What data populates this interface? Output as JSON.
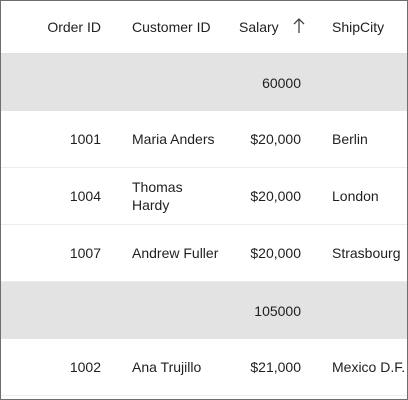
{
  "grid": {
    "columns": [
      "Order ID",
      "Customer ID",
      "Salary",
      "ShipCity"
    ],
    "sort": {
      "column": "Salary",
      "direction": "ascending",
      "icon": "arrow-up-icon"
    },
    "groups": [
      {
        "caption": "60000",
        "rows": [
          {
            "order_id": "1001",
            "customer": "Maria Anders",
            "salary": "$20,000",
            "city": "Berlin"
          },
          {
            "order_id": "1004",
            "customer": "Thomas Hardy",
            "salary": "$20,000",
            "city": "London"
          },
          {
            "order_id": "1007",
            "customer": "Andrew Fuller",
            "salary": "$20,000",
            "city": "Strasbourg"
          }
        ]
      },
      {
        "caption": "105000",
        "rows": [
          {
            "order_id": "1002",
            "customer": "Ana Trujillo",
            "salary": "$21,000",
            "city": "Mexico D.F."
          }
        ]
      }
    ]
  }
}
